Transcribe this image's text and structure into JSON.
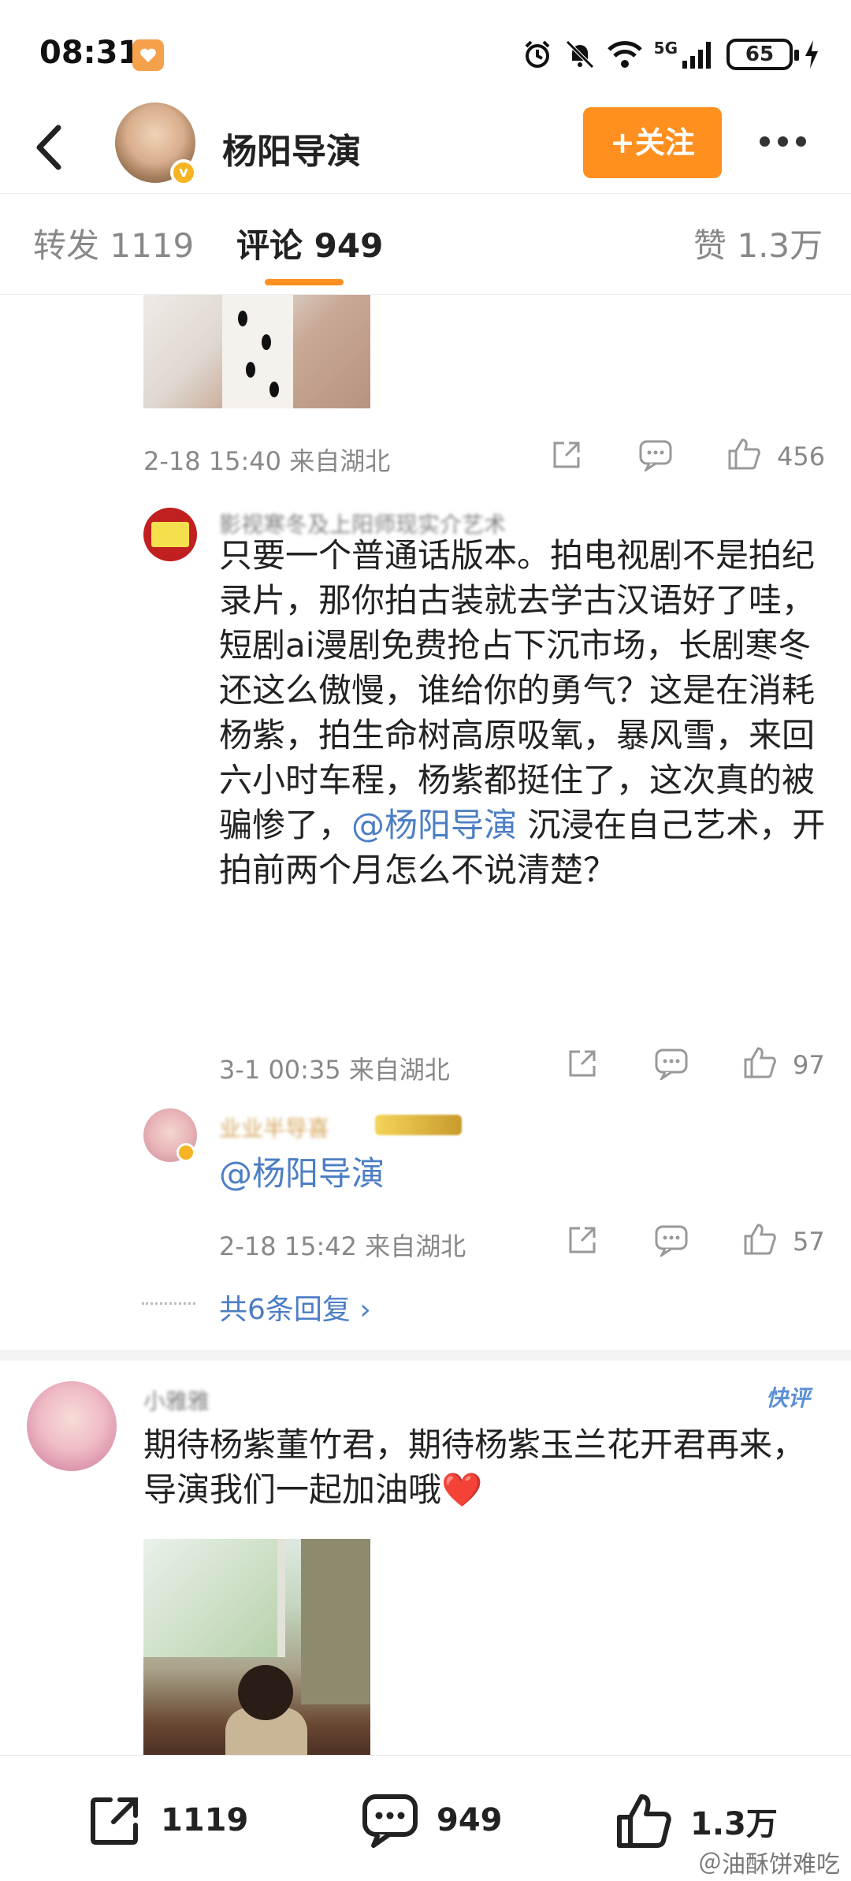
{
  "status_bar": {
    "time": "08:31",
    "network": "5G",
    "battery": "65"
  },
  "header": {
    "user_name": "杨阳导演",
    "follow_label": "+关注"
  },
  "tabs": [
    {
      "label": "转发 1119"
    },
    {
      "label": "评论 949"
    },
    {
      "label": "赞 1.3万"
    }
  ],
  "comments": [
    {
      "meta": "2-18 15:40 来自湖北",
      "likes": "456"
    },
    {
      "author": "影视寒冬及上阳师现实介艺术",
      "text": "只要一个普通话版本。拍电视剧不是拍纪录片，那你拍古装就去学古汉语好了哇，短剧ai漫剧免费抢占下沉市场，长剧寒冬还这么傲慢，谁给你的勇气？这是在消耗杨紫，拍生命树高原吸氧，暴风雪，来回六小时车程，杨紫都挺住了，这次真的被骗惨了，",
      "mention": "@杨阳导演",
      "text_after": " 沉浸在自己艺术，开拍前两个月怎么不说清楚？",
      "meta": "3-1 00:35 来自湖北",
      "likes": "97"
    },
    {
      "author": "业业半导喜",
      "mention": "@杨阳导演",
      "meta": "2-18 15:42 来自湖北",
      "likes": "57"
    },
    {
      "author": "小雅雅",
      "badge": "快评",
      "text": "期待杨紫董竹君，期待杨紫玉兰花开君再来，导演我们一起加油哦❤️"
    }
  ],
  "replies_link": "共6条回复 ›",
  "bottom_bar": {
    "repost_count": "1119",
    "comment_count": "949",
    "like_count": "1.3万"
  },
  "watermark": "＠油酥饼难吃"
}
